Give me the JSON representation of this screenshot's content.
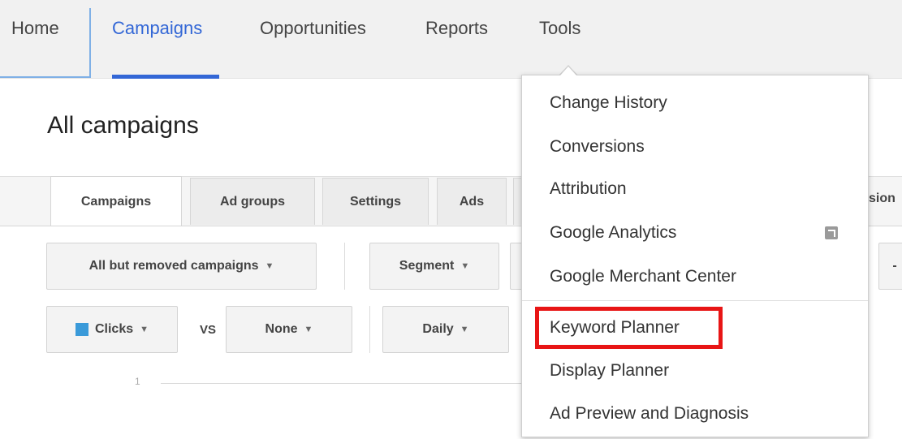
{
  "nav": {
    "items": [
      "Home",
      "Campaigns",
      "Opportunities",
      "Reports",
      "Tools"
    ],
    "active": "Campaigns",
    "accent_color": "#3367d6"
  },
  "page": {
    "title": "All campaigns"
  },
  "tabs": {
    "items": [
      "Campaigns",
      "Ad groups",
      "Settings",
      "Ads"
    ],
    "active": "Campaigns",
    "clipped_right": "sion"
  },
  "toolbar": {
    "filter_label": "All but removed campaigns",
    "segment_label": "Segment",
    "clipped_right": "-"
  },
  "chart_controls": {
    "metric_label": "Clicks",
    "metric_color": "#3a9ad9",
    "vs_label": "VS",
    "compare_label": "None",
    "interval_label": "Daily"
  },
  "chart": {
    "y_tick": "1"
  },
  "tools_menu": {
    "items": [
      {
        "label": "Change History",
        "external": false
      },
      {
        "label": "Conversions",
        "external": false
      },
      {
        "label": "Attribution",
        "external": false
      },
      {
        "label": "Google Analytics",
        "external": true,
        "icon": "external-link-icon"
      },
      {
        "label": "Google Merchant Center",
        "external": false
      },
      {
        "label": "Keyword Planner",
        "external": false,
        "highlighted": true
      },
      {
        "label": "Display Planner",
        "external": false
      },
      {
        "label": "Ad Preview and Diagnosis",
        "external": false
      }
    ],
    "highlight_color": "#e81515"
  }
}
